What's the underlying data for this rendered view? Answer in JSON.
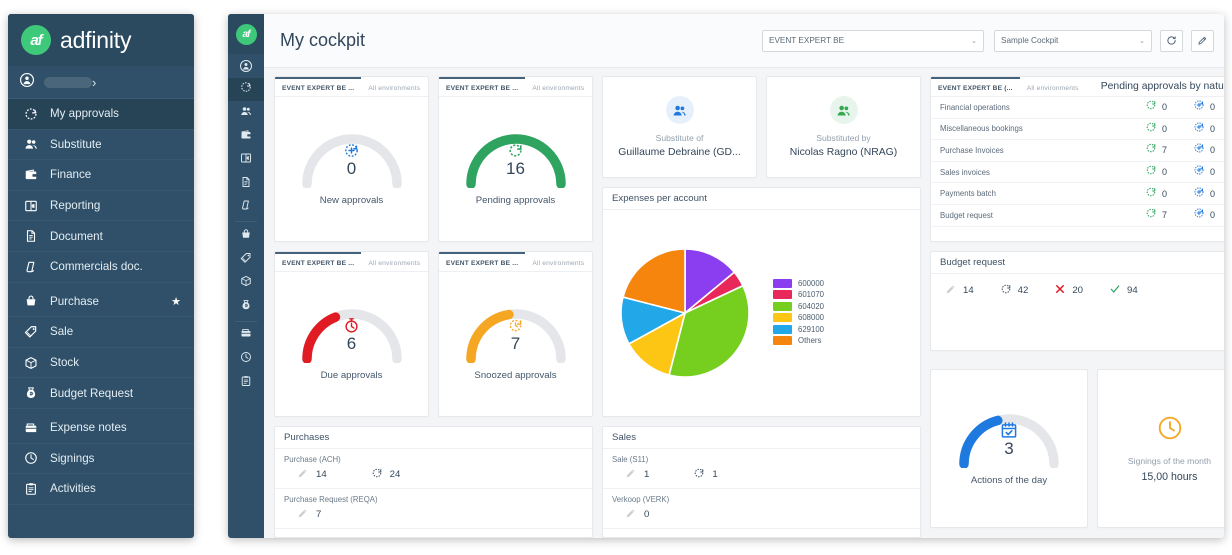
{
  "brand": {
    "logo_text": "af",
    "name": "adfinity"
  },
  "sidebar": {
    "user_label": "",
    "items": [
      {
        "label": "My approvals",
        "icon": "refresh-approval-icon",
        "active": true,
        "star": false
      },
      {
        "label": "Substitute",
        "icon": "users-icon",
        "active": false,
        "star": false
      },
      {
        "label": "Finance",
        "icon": "wallet-icon",
        "active": false,
        "star": false
      },
      {
        "label": "Reporting",
        "icon": "book-euro-icon",
        "active": false,
        "star": false
      },
      {
        "label": "Document",
        "icon": "document-icon",
        "active": false,
        "star": false
      },
      {
        "label": "Commercials doc.",
        "icon": "page-corner-icon",
        "active": false,
        "star": false
      },
      {
        "label": "Purchase",
        "icon": "basket-icon",
        "active": false,
        "star": true
      },
      {
        "label": "Sale",
        "icon": "tag-icon",
        "active": false,
        "star": false
      },
      {
        "label": "Stock",
        "icon": "box-icon",
        "active": false,
        "star": false
      },
      {
        "label": "Budget Request",
        "icon": "money-bag-icon",
        "active": false,
        "star": false
      },
      {
        "label": "Expense notes",
        "icon": "receipt-icon",
        "active": false,
        "star": false
      },
      {
        "label": "Signings",
        "icon": "clock-icon",
        "active": false,
        "star": false
      },
      {
        "label": "Activities",
        "icon": "clipboard-icon",
        "active": false,
        "star": false
      }
    ],
    "star_glyph": "★",
    "chevron_glyph": "›"
  },
  "topbar": {
    "title": "My cockpit",
    "env_select": {
      "value": "EVENT EXPERT BE",
      "caret": "⌄"
    },
    "cockpit_select": {
      "value": "Sample Cockpit",
      "caret": "⌄"
    },
    "refresh_button": "refresh-icon",
    "edit_button": "pencil-icon"
  },
  "card_tabs": {
    "primary": "EVENT EXPERT BE ...",
    "secondary": "All environments"
  },
  "gauges": [
    {
      "id": "new-approvals",
      "value": "0",
      "label": "New approvals",
      "color": "#1f7ae0",
      "track": "#e4e6e9",
      "pct": 0,
      "icon": "add-refresh-icon"
    },
    {
      "id": "pending-approvals",
      "value": "16",
      "label": "Pending approvals",
      "color": "#2fa360",
      "track": "#e4e6e9",
      "pct": 100,
      "icon": "refresh-icon"
    },
    {
      "id": "due-approvals",
      "value": "6",
      "label": "Due approvals",
      "color": "#e01b24",
      "track": "#e4e6e9",
      "pct": 38,
      "icon": "stopwatch-icon"
    },
    {
      "id": "snoozed-approvals",
      "value": "7",
      "label": "Snoozed approvals",
      "color": "#f5a623",
      "track": "#e4e6e9",
      "pct": 45,
      "icon": "snooze-clock-icon"
    }
  ],
  "substitutes": [
    {
      "id": "substitute-of",
      "caption": "Substitute of",
      "name": "Guillaume Debraine (GD...",
      "color": "#1f7ae0",
      "bg": "#e6f0fb"
    },
    {
      "id": "substituted-by",
      "caption": "Substituted by",
      "name": "Nicolas Ragno (NRAG)",
      "color": "#34a853",
      "bg": "#e8f5ec"
    }
  ],
  "expenses": {
    "title": "Expenses per account"
  },
  "chart_data": {
    "type": "pie",
    "title": "Expenses per account",
    "labels": [
      "600000",
      "601070",
      "604020",
      "608000",
      "629100",
      "Others"
    ],
    "values": [
      14,
      4,
      36,
      13,
      12,
      21
    ],
    "colors": [
      "#8b3df0",
      "#e8275a",
      "#76ce1e",
      "#fdc614",
      "#22a7e8",
      "#f5850d"
    ],
    "legend_position": "right",
    "start_angle": 0
  },
  "nature": {
    "title": "Pending approvals by nature",
    "rows": [
      {
        "name": "Financial operations",
        "pending": "0",
        "other": "0"
      },
      {
        "name": "Miscellaneous bookings",
        "pending": "0",
        "other": "0"
      },
      {
        "name": "Purchase Invoices",
        "pending": "7",
        "other": "0"
      },
      {
        "name": "Sales invoices",
        "pending": "0",
        "other": "0"
      },
      {
        "name": "Payments batch",
        "pending": "0",
        "other": "0"
      },
      {
        "name": "Budget request",
        "pending": "7",
        "other": "0"
      }
    ],
    "tab_primary": "EVENT EXPERT BE (...",
    "tab_secondary": "All environments"
  },
  "budget_request": {
    "title": "Budget request",
    "stats": [
      {
        "icon": "pencil-icon",
        "value": "14",
        "color": "#c9ccd1"
      },
      {
        "icon": "refresh-icon",
        "value": "42",
        "color": "#44576a"
      },
      {
        "icon": "cross-icon",
        "value": "20",
        "color": "#e01b24"
      },
      {
        "icon": "check-icon",
        "value": "94",
        "color": "#2fa360"
      }
    ]
  },
  "actions_of_day": {
    "value": "3",
    "label": "Actions of the day",
    "color": "#1f7ae0",
    "track": "#e4e6e9",
    "pct": 42,
    "icon": "calendar-check-icon"
  },
  "signings": {
    "icon": "clock-icon",
    "caption": "Signings of the month",
    "value": "15,00 hours",
    "color": "#f5a623"
  },
  "purchases": {
    "title": "Purchases",
    "groups": [
      {
        "name": "Purchase (ACH)",
        "stats": [
          {
            "icon": "pencil-icon",
            "value": "14",
            "color": "#c9ccd1"
          },
          {
            "icon": "refresh-icon",
            "value": "24",
            "color": "#44576a"
          }
        ]
      },
      {
        "name": "Purchase Request (REQA)",
        "stats": [
          {
            "icon": "pencil-icon",
            "value": "7",
            "color": "#c9ccd1"
          }
        ]
      }
    ]
  },
  "sales": {
    "title": "Sales",
    "groups": [
      {
        "name": "Sale (S11)",
        "stats": [
          {
            "icon": "pencil-icon",
            "value": "1",
            "color": "#c9ccd1"
          },
          {
            "icon": "refresh-icon",
            "value": "1",
            "color": "#44576a"
          }
        ]
      },
      {
        "name": "Verkoop (VERK)",
        "stats": [
          {
            "icon": "pencil-icon",
            "value": "0",
            "color": "#c9ccd1"
          }
        ]
      }
    ]
  }
}
